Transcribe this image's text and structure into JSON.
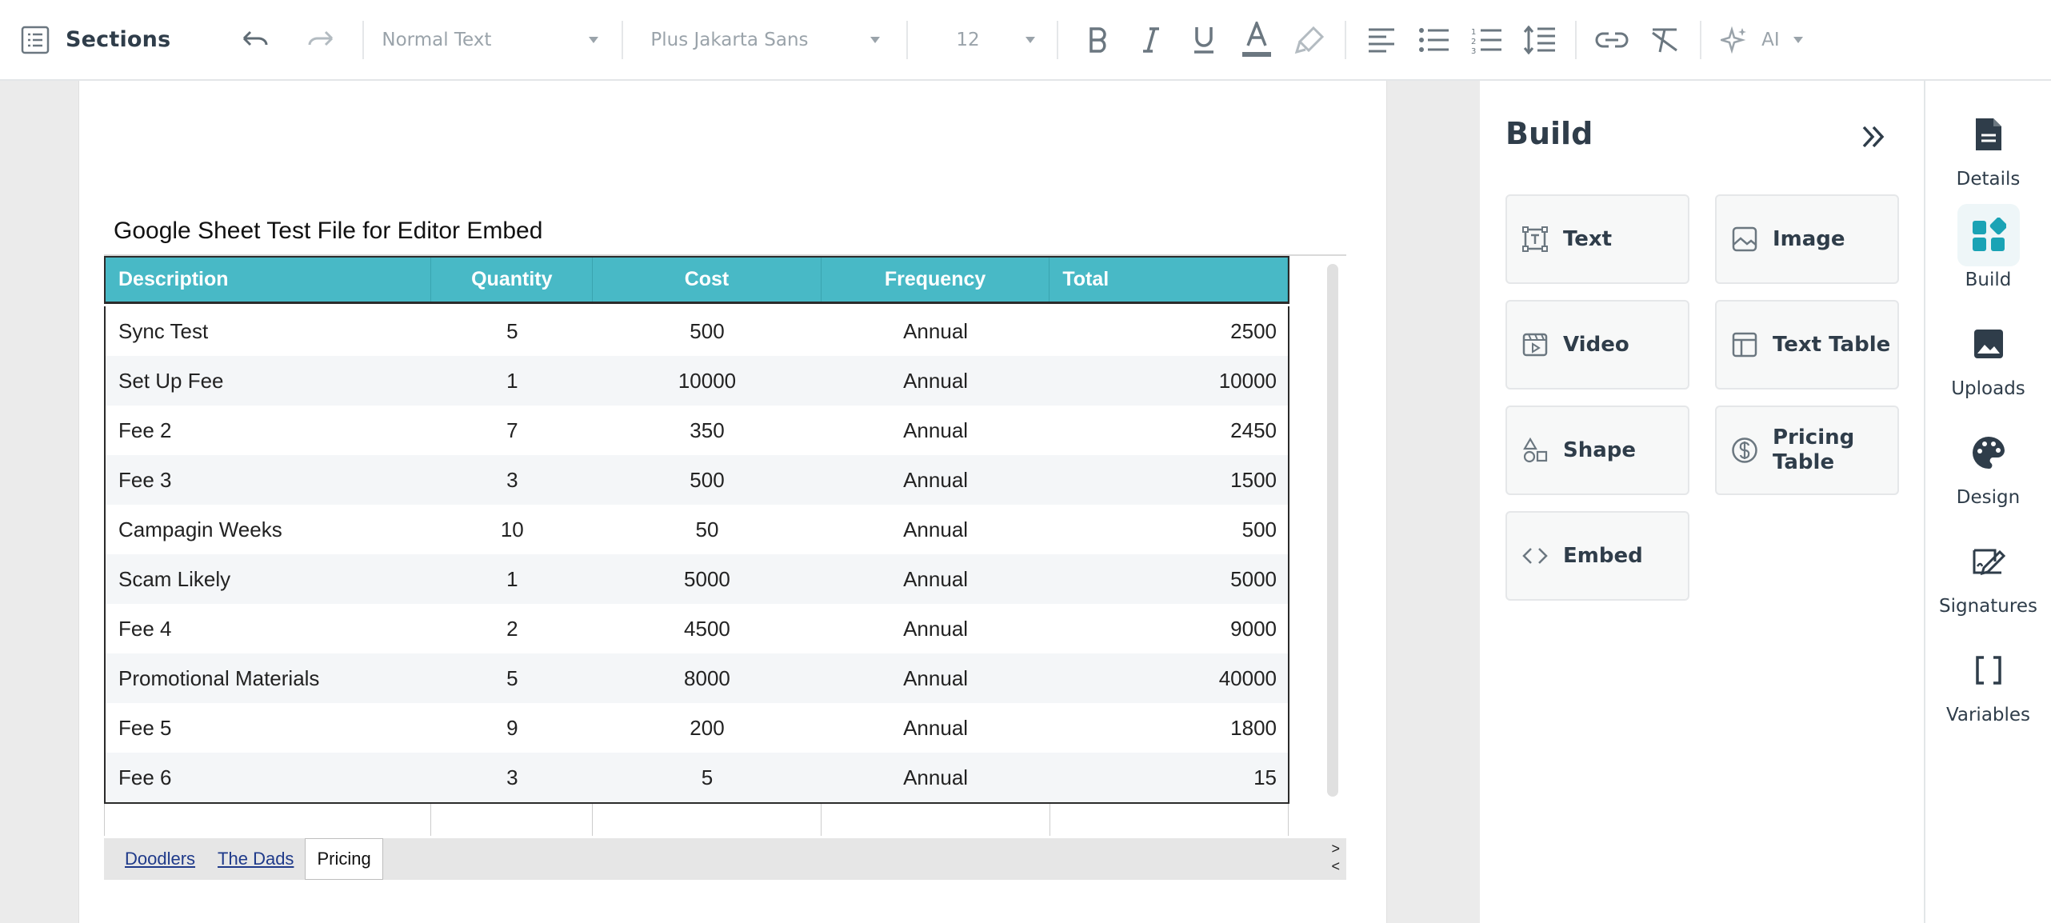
{
  "toolbar": {
    "sections_label": "Sections",
    "text_style": "Normal Text",
    "font": "Plus Jakarta Sans",
    "font_size": "12",
    "ai_label": "AI"
  },
  "document": {
    "embed_title": "Google Sheet Test File for Editor Embed",
    "sheet": {
      "columns": [
        "Description",
        "Quantity",
        "Cost",
        "Frequency",
        "Total"
      ],
      "rows": [
        [
          "Sync Test",
          "5",
          "500",
          "Annual",
          "2500"
        ],
        [
          "Set Up Fee",
          "1",
          "10000",
          "Annual",
          "10000"
        ],
        [
          "Fee 2",
          "7",
          "350",
          "Annual",
          "2450"
        ],
        [
          "Fee 3",
          "3",
          "500",
          "Annual",
          "1500"
        ],
        [
          "Campagin Weeks",
          "10",
          "50",
          "Annual",
          "500"
        ],
        [
          "Scam Likely",
          "1",
          "5000",
          "Annual",
          "5000"
        ],
        [
          "Fee 4",
          "2",
          "4500",
          "Annual",
          "9000"
        ],
        [
          "Promotional Materials",
          "5",
          "8000",
          "Annual",
          "40000"
        ],
        [
          "Fee 5",
          "9",
          "200",
          "Annual",
          "1800"
        ],
        [
          "Fee 6",
          "3",
          "5",
          "Annual",
          "15"
        ]
      ],
      "tabs": [
        "Doodlers",
        "The Dads",
        "Pricing"
      ],
      "active_tab": "Pricing",
      "scroll_arrows": [
        ">",
        "<"
      ]
    }
  },
  "build_panel": {
    "title": "Build",
    "tiles": [
      "Text",
      "Image",
      "Video",
      "Text Table",
      "Shape",
      "Pricing Table",
      "Embed"
    ]
  },
  "rail": {
    "items": [
      "Details",
      "Build",
      "Uploads",
      "Design",
      "Signatures",
      "Variables"
    ],
    "active": "Build"
  },
  "colors": {
    "header_teal": "#48b9c6",
    "accent": "#1aa3b5",
    "text_dark": "#2f3d4a",
    "muted": "#9aa3aa"
  }
}
